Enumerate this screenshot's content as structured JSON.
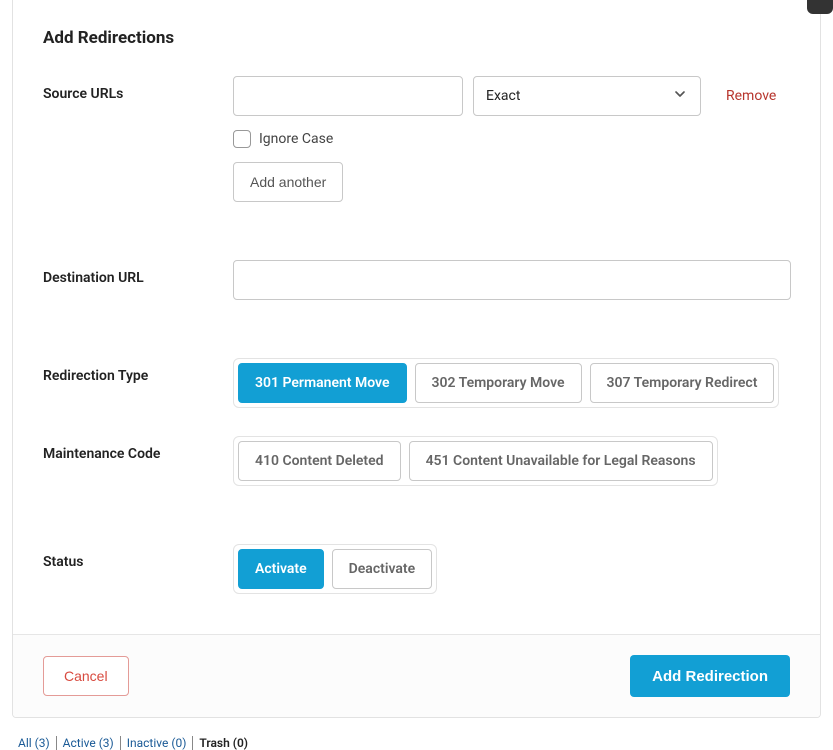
{
  "title": "Add Redirections",
  "source": {
    "label": "Source URLs",
    "url_value": "",
    "match_type_selected": "Exact",
    "remove_label": "Remove",
    "ignore_case_label": "Ignore Case",
    "ignore_case_checked": false,
    "add_another_label": "Add another"
  },
  "destination": {
    "label": "Destination URL",
    "value": ""
  },
  "redirection_type": {
    "label": "Redirection Type",
    "options": [
      {
        "label": "301 Permanent Move",
        "active": true
      },
      {
        "label": "302 Temporary Move",
        "active": false
      },
      {
        "label": "307 Temporary Redirect",
        "active": false
      }
    ]
  },
  "maintenance_code": {
    "label": "Maintenance Code",
    "options": [
      {
        "label": "410 Content Deleted",
        "active": false
      },
      {
        "label": "451 Content Unavailable for Legal Reasons",
        "active": false
      }
    ]
  },
  "status": {
    "label": "Status",
    "options": [
      {
        "label": "Activate",
        "active": true
      },
      {
        "label": "Deactivate",
        "active": false
      }
    ]
  },
  "footer": {
    "cancel": "Cancel",
    "submit": "Add Redirection"
  },
  "tabs": [
    {
      "label": "All (3)",
      "current": false
    },
    {
      "label": "Active (3)",
      "current": false
    },
    {
      "label": "Inactive (0)",
      "current": false
    },
    {
      "label": "Trash (0)",
      "current": true
    }
  ]
}
